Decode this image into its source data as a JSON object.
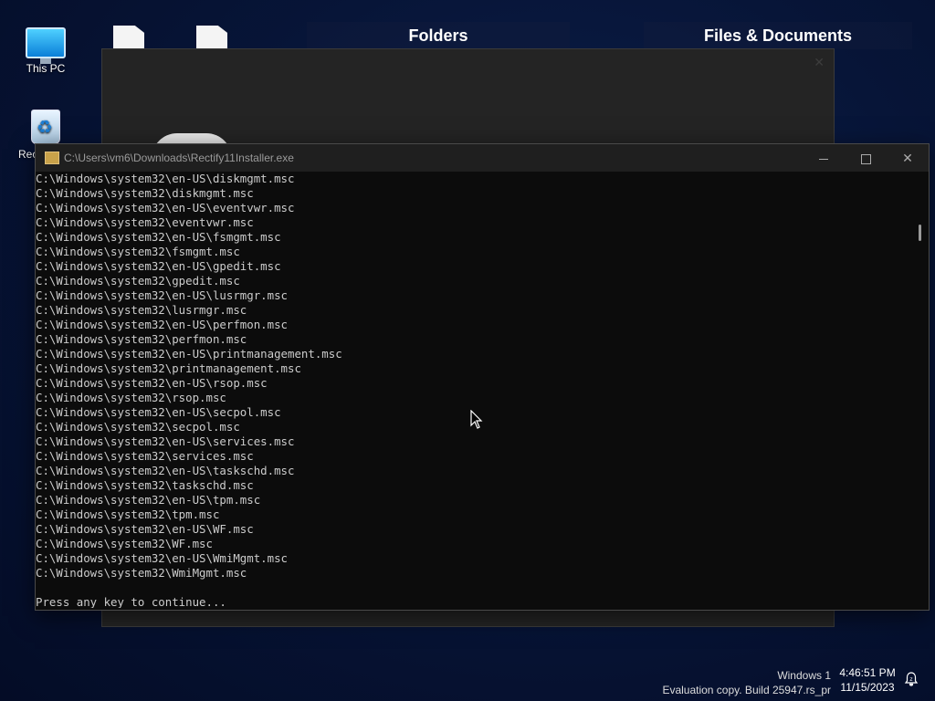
{
  "desktop": {
    "icons": [
      {
        "label": "This PC"
      },
      {
        "label": "Rec"
      }
    ]
  },
  "widgets": {
    "folders_header": "Folders",
    "files_header": "Files & Documents"
  },
  "console": {
    "title": "C:\\Users\\vm6\\Downloads\\Rectify11Installer.exe",
    "lines": [
      "C:\\Windows\\system32\\en-US\\diskmgmt.msc",
      "C:\\Windows\\system32\\diskmgmt.msc",
      "C:\\Windows\\system32\\en-US\\eventvwr.msc",
      "C:\\Windows\\system32\\eventvwr.msc",
      "C:\\Windows\\system32\\en-US\\fsmgmt.msc",
      "C:\\Windows\\system32\\fsmgmt.msc",
      "C:\\Windows\\system32\\en-US\\gpedit.msc",
      "C:\\Windows\\system32\\gpedit.msc",
      "C:\\Windows\\system32\\en-US\\lusrmgr.msc",
      "C:\\Windows\\system32\\lusrmgr.msc",
      "C:\\Windows\\system32\\en-US\\perfmon.msc",
      "C:\\Windows\\system32\\perfmon.msc",
      "C:\\Windows\\system32\\en-US\\printmanagement.msc",
      "C:\\Windows\\system32\\printmanagement.msc",
      "C:\\Windows\\system32\\en-US\\rsop.msc",
      "C:\\Windows\\system32\\rsop.msc",
      "C:\\Windows\\system32\\en-US\\secpol.msc",
      "C:\\Windows\\system32\\secpol.msc",
      "C:\\Windows\\system32\\en-US\\services.msc",
      "C:\\Windows\\system32\\services.msc",
      "C:\\Windows\\system32\\en-US\\taskschd.msc",
      "C:\\Windows\\system32\\taskschd.msc",
      "C:\\Windows\\system32\\en-US\\tpm.msc",
      "C:\\Windows\\system32\\tpm.msc",
      "C:\\Windows\\system32\\en-US\\WF.msc",
      "C:\\Windows\\system32\\WF.msc",
      "C:\\Windows\\system32\\en-US\\WmiMgmt.msc",
      "C:\\Windows\\system32\\WmiMgmt.msc",
      "",
      "Press any key to continue..."
    ]
  },
  "watermark": {
    "line1": "Windows 1",
    "line2": "Evaluation copy. Build 25947.rs_pr"
  },
  "clock": {
    "time": "4:46:51 PM",
    "date": "11/15/2023"
  },
  "icons": {
    "this_pc": "monitor-icon",
    "recycle_bin": "recycle-bin-icon",
    "console_app": "app-icon",
    "notifications": "notification-bell-icon"
  }
}
